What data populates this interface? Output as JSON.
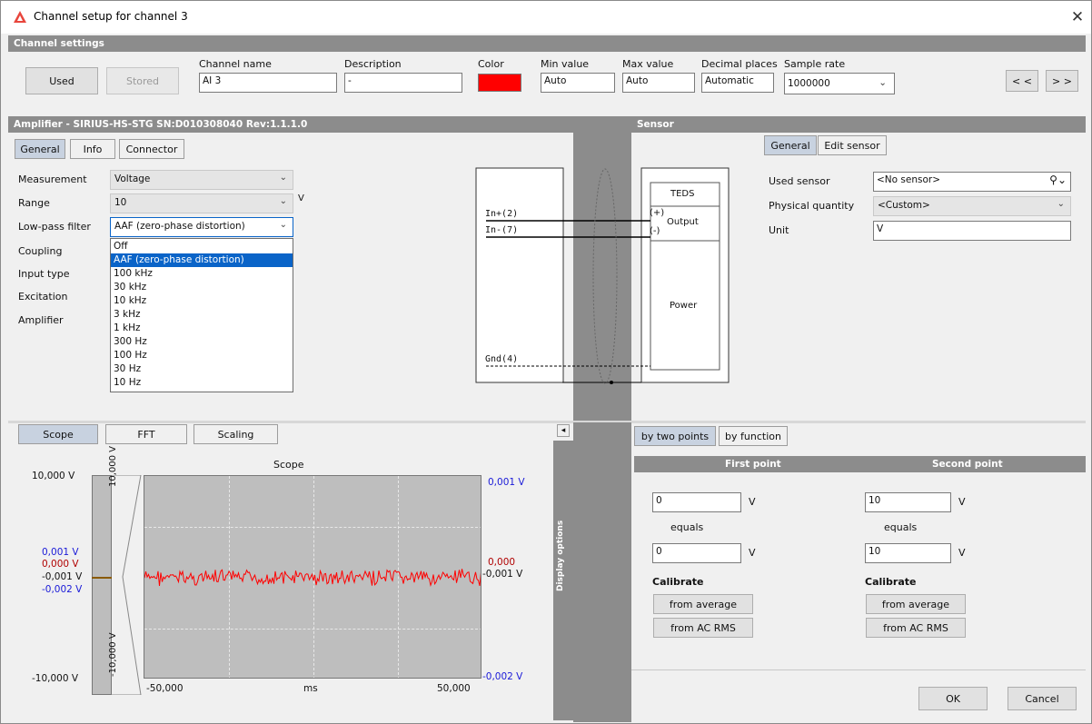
{
  "window": {
    "title": "Channel setup for channel 3",
    "close_label": "✕"
  },
  "channel_settings": {
    "header": "Channel settings",
    "used_label": "Used",
    "stored_label": "Stored",
    "name_label": "Channel name",
    "name_value": "AI 3",
    "description_label": "Description",
    "description_value": "-",
    "color_label": "Color",
    "color_value": "#ff0000",
    "min_label": "Min value",
    "min_value": "Auto",
    "max_label": "Max value",
    "max_value": "Auto",
    "decimal_label": "Decimal places",
    "decimal_value": "Automatic",
    "rate_label": "Sample rate",
    "rate_value": "1000000",
    "prev_label": "< <",
    "next_label": "> >"
  },
  "amplifier": {
    "header": "Amplifier - SIRIUS-HS-STG  SN:D010308040 Rev:1.1.1.0",
    "tabs": [
      "General",
      "Info",
      "Connector"
    ],
    "measurement_label": "Measurement",
    "measurement_value": "Voltage",
    "range_label": "Range",
    "range_value": "10",
    "range_unit": "V",
    "lowpass_label": "Low-pass filter",
    "lowpass_value": "AAF (zero-phase distortion)",
    "coupling_label": "Coupling",
    "input_type_label": "Input type",
    "excitation_label": "Excitation",
    "amplifier_label": "Amplifier",
    "dropdown_options": [
      "Off",
      "AAF (zero-phase distortion)",
      "100 kHz",
      "30 kHz",
      "10 kHz",
      "3 kHz",
      "1 kHz",
      "300 Hz",
      "100 Hz",
      "30 Hz",
      "10 Hz"
    ]
  },
  "diagram": {
    "in_plus": "In+(2)",
    "in_minus": "In-(7)",
    "gnd": "Gnd(4)",
    "teds": "TEDS",
    "plus": "(+)",
    "minus": "(-)",
    "output": "Output",
    "power": "Power"
  },
  "sensor": {
    "header": "Sensor",
    "tabs": [
      "General",
      "Edit sensor"
    ],
    "used_sensor_label": "Used sensor",
    "used_sensor_value": "<No sensor>",
    "physical_label": "Physical quantity",
    "physical_value": "<Custom>",
    "unit_label": "Unit",
    "unit_value": "V"
  },
  "scope": {
    "tabs": [
      "Scope",
      "FFT",
      "Scaling"
    ],
    "title": "Scope",
    "collapse_label": "◂",
    "display_options": "Display options",
    "left_labels": {
      "top": "10,000 V",
      "bottom": "-10,000 V"
    },
    "mini_left": {
      "a": "0,001 V",
      "b": "0,000 V",
      "c": "-0,001 V",
      "d": "-0,002 V"
    },
    "bar_top": "10,000 V",
    "bar_bottom": "-10,000 V",
    "right_top": "0,001 V",
    "right_mid_a": "0,000",
    "right_mid_b": "-0,001 V",
    "right_bottom": "-0,002 V",
    "x_left": "-50,000",
    "x_unit": "ms",
    "x_right": "50,000"
  },
  "scaling": {
    "tabs": [
      "by two points",
      "by function"
    ],
    "first_point": "First point",
    "second_point": "Second point",
    "p1_in": "0",
    "p1_out": "0",
    "p2_in": "10",
    "p2_out": "10",
    "unit": "V",
    "equals": "equals",
    "calibrate": "Calibrate",
    "from_average": "from average",
    "from_ac_rms": "from AC RMS"
  },
  "footer": {
    "ok": "OK",
    "cancel": "Cancel"
  },
  "colors": {
    "accent": "#0a64c8",
    "signal": "#ff0000",
    "header_bg": "#8c8c8c"
  }
}
